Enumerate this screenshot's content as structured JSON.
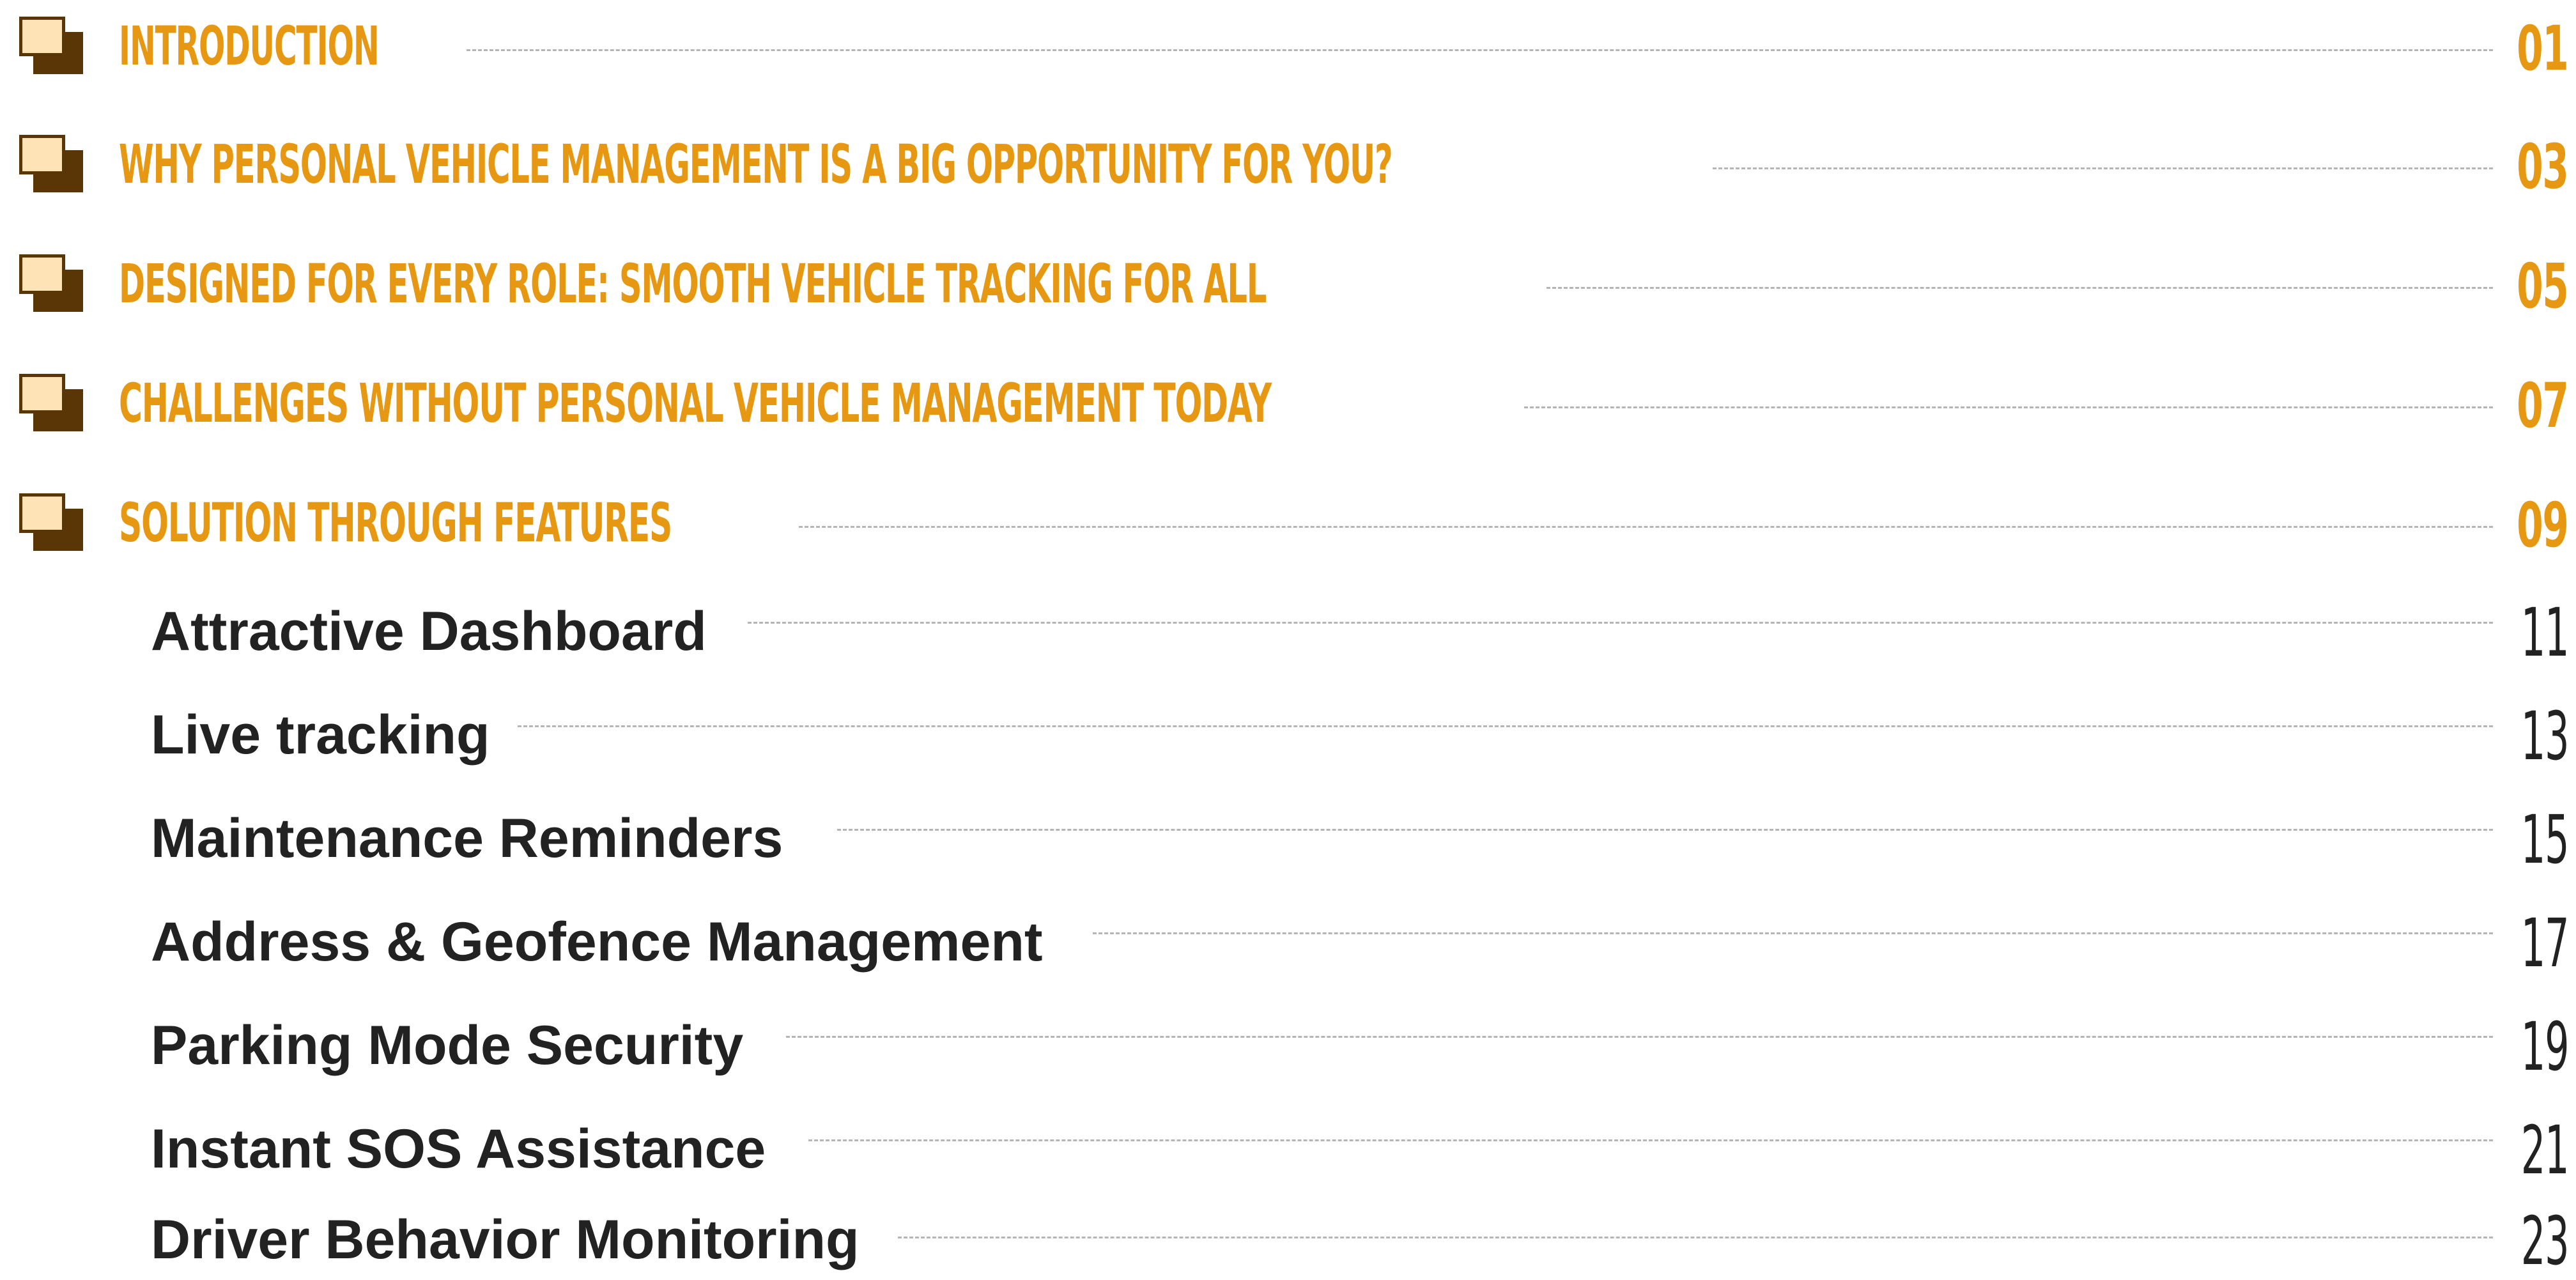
{
  "toc": {
    "main_items": [
      {
        "title": "INTRODUCTION",
        "page": "01"
      },
      {
        "title": "WHY PERSONAL VEHICLE MANAGEMENT IS A BIG OPPORTUNITY FOR YOU?",
        "page": "03"
      },
      {
        "title": "DESIGNED FOR EVERY ROLE: SMOOTH VEHICLE TRACKING FOR ALL",
        "page": "05"
      },
      {
        "title": "CHALLENGES WITHOUT PERSONAL VEHICLE MANAGEMENT TODAY",
        "page": "07"
      },
      {
        "title": "SOLUTION THROUGH FEATURES",
        "page": "09"
      }
    ],
    "sub_items": [
      {
        "title": "Attractive Dashboard",
        "page": "11"
      },
      {
        "title": "Live tracking",
        "page": "13"
      },
      {
        "title": "Maintenance Reminders",
        "page": "15"
      },
      {
        "title": "Address & Geofence Management",
        "page": "17"
      },
      {
        "title": "Parking Mode Security",
        "page": "19"
      },
      {
        "title": "Instant SOS Assistance",
        "page": "21"
      },
      {
        "title": "Driver Behavior Monitoring",
        "page": "23"
      }
    ],
    "colors": {
      "main_title": "#e69813",
      "sub_title": "#222222",
      "icon_dark": "#5a3607",
      "icon_light": "#fde3b6",
      "leader": "#b5b5b5"
    },
    "icon_name": "section-square-icon"
  }
}
